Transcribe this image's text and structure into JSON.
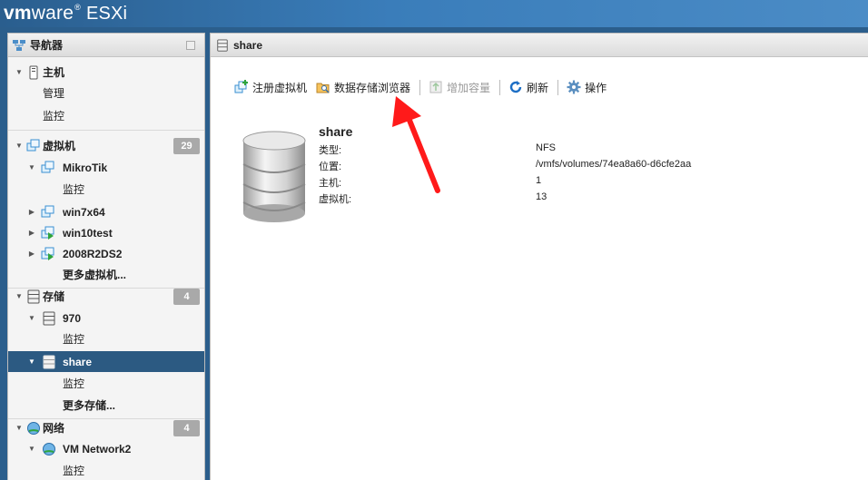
{
  "brand": {
    "vendor_bold": "vm",
    "vendor_rest": "ware",
    "product": "ESXi"
  },
  "navigator": {
    "title": "导航器",
    "items": [
      {
        "label": "主机",
        "icon": "host-icon"
      },
      {
        "label": "管理"
      },
      {
        "label": "监控"
      },
      {
        "label": "虚拟机",
        "icon": "vm-group-icon",
        "badge": "29"
      },
      {
        "label": "MikroTik",
        "icon": "vm-icon"
      },
      {
        "label": "监控"
      },
      {
        "label": "win7x64",
        "icon": "vm-icon"
      },
      {
        "label": "win10test",
        "icon": "vm-running-icon"
      },
      {
        "label": "2008R2DS2",
        "icon": "vm-running-icon"
      },
      {
        "label": "更多虚拟机..."
      },
      {
        "label": "存储",
        "icon": "storage-icon",
        "badge": "4"
      },
      {
        "label": "970",
        "icon": "datastore-icon"
      },
      {
        "label": "监控"
      },
      {
        "label": "share",
        "icon": "datastore-icon"
      },
      {
        "label": "监控"
      },
      {
        "label": "更多存储..."
      },
      {
        "label": "网络",
        "icon": "network-icon",
        "badge": "4"
      },
      {
        "label": "VM Network2",
        "icon": "network-icon"
      },
      {
        "label": "监控"
      }
    ]
  },
  "main": {
    "title": "share",
    "toolbar": {
      "register_vm": "注册虚拟机",
      "datastore_browser": "数据存储浏览器",
      "increase_capacity": "增加容量",
      "refresh": "刷新",
      "actions": "操作"
    },
    "details": {
      "name": "share",
      "type_label": "类型:",
      "type_value": "NFS",
      "location_label": "位置:",
      "location_value": "/vmfs/volumes/74ea8a60-d6cfe2aa",
      "hosts_label": "主机:",
      "hosts_value": "1",
      "vms_label": "虚拟机:",
      "vms_value": "13"
    }
  },
  "colors": {
    "brand_bar": "#3a7dba",
    "selected_row": "#2c5a82",
    "badge": "#a9a9a9",
    "annotation_arrow": "#ff1a1a"
  }
}
